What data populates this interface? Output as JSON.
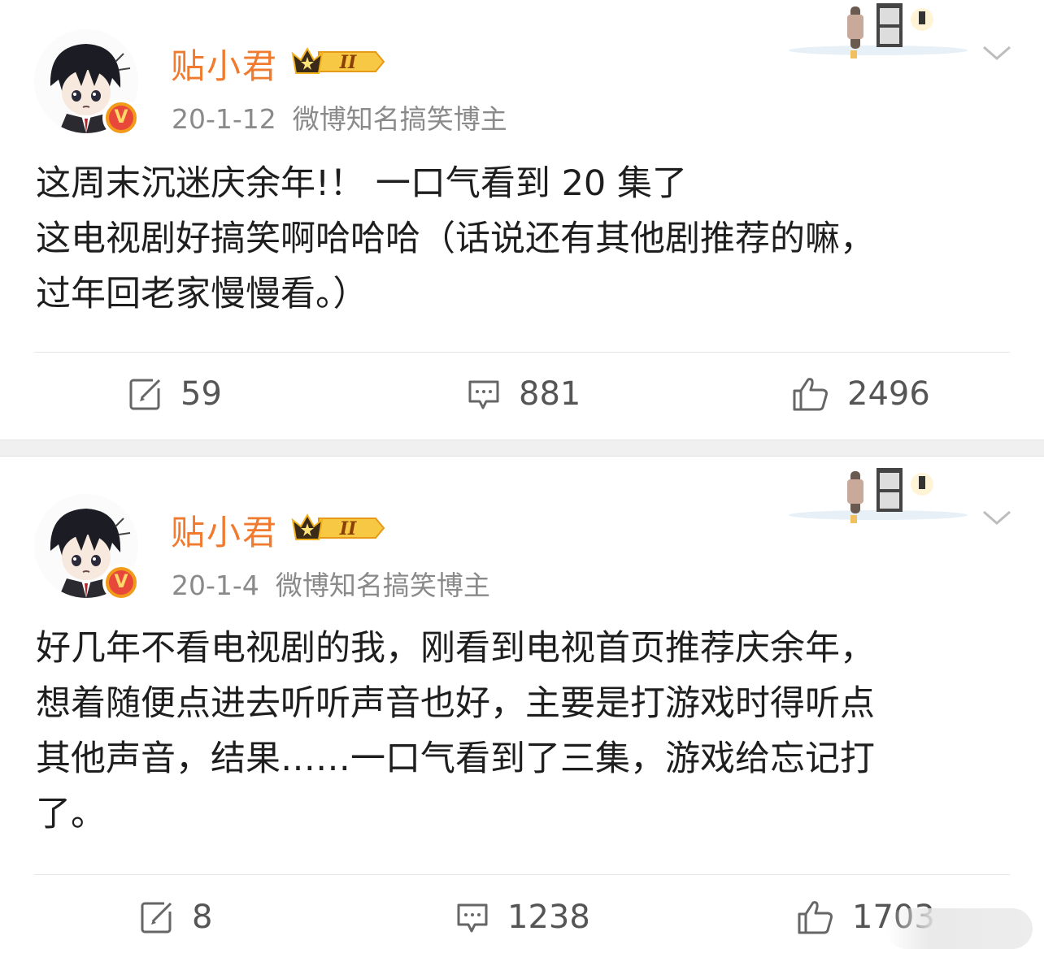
{
  "posts": [
    {
      "username": "贴小君",
      "date": "20-1-12",
      "verified_title": "微博知名搞笑博主",
      "content_lines": [
        "这周末沉迷庆余年!！ 一口气看到 20 集了",
        "这电视剧好搞笑啊哈哈哈（话说还有其他剧推荐的嘛，",
        "过年回老家慢慢看。）"
      ],
      "reposts": "59",
      "comments": "881",
      "likes": "2496"
    },
    {
      "username": "贴小君",
      "date": "20-1-4",
      "verified_title": "微博知名搞笑博主",
      "content_lines": [
        "好几年不看电视剧的我，刚看到电视首页推荐庆余年，",
        "想着随便点进去听听声音也好，主要是打游戏时得听点",
        "其他声音，结果……一口气看到了三集，游戏给忘记打",
        "了。"
      ],
      "reposts": "8",
      "comments": "1238",
      "likes": "1703"
    }
  ],
  "badge": {
    "rank_label": "II",
    "verified_mark": "V"
  },
  "colors": {
    "username": "#f07a2e",
    "meta": "#8a8a8a",
    "badge_gold": "#f5b323",
    "verified_orange": "#f29a19"
  },
  "icons": [
    "avatar-image",
    "crown-rank-badge-icon",
    "verified-v-icon",
    "chevron-down-icon",
    "repost-icon",
    "comment-icon",
    "like-icon",
    "decoration-sticker"
  ]
}
